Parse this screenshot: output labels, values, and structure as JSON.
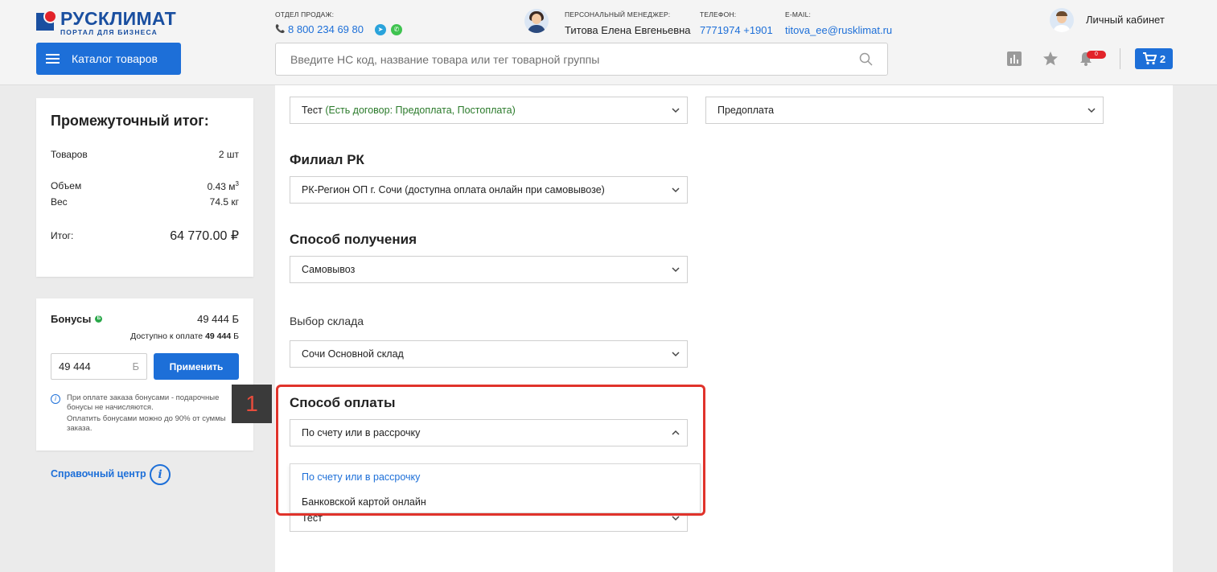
{
  "header": {
    "logo_name": "РУСКЛИМАТ",
    "logo_sub": "ПОРТАЛ ДЛЯ БИЗНЕСА",
    "sales_caption": "ОТДЕЛ ПРОДАЖ:",
    "sales_phone": "8 800 234 69 80",
    "manager_caption": "ПЕРСОНАЛЬНЫЙ МЕНЕДЖЕР:",
    "manager_name": "Титова Елена Евгеньевна",
    "phone_caption": "ТЕЛЕФОН:",
    "phone_value": "7771974 +1901",
    "email_caption": "E-MAIL:",
    "email_value": "titova_ee@rusklimat.ru",
    "cabinet_label": "Личный кабинет",
    "catalog_label": "Каталог товаров",
    "search_placeholder": "Введите НС код, название товара или тег товарной группы",
    "notifications_count": "0",
    "cart_count": "2",
    "accent_color": "#1d6fd8"
  },
  "summary": {
    "title": "Промежуточный итог:",
    "items_label": "Товаров",
    "items_value": "2 шт",
    "volume_label": "Объем",
    "volume_value": "0.43 м",
    "volume_sup": "3",
    "weight_label": "Вес",
    "weight_value": "74.5 кг",
    "total_label": "Итог:",
    "total_value": "64 770.00 ₽"
  },
  "bonus": {
    "title": "Бонусы",
    "badge": "Б",
    "value": "49 444 Б",
    "available_prefix": "Доступно к оплате",
    "available_value": "49 444",
    "available_unit": "Б",
    "input_value": "49 444",
    "input_unit": "Б",
    "apply_label": "Применить",
    "note_line1": "При оплате заказа бонусами - подарочные бонусы не начисляются.",
    "note_line2": "Оплатить бонусами можно до 90% от суммы заказа."
  },
  "help": {
    "label": "Справочный центр"
  },
  "form": {
    "contract_select": "Тест",
    "contract_note": "(Есть договор: Предоплата, Постоплата)",
    "payment_type_select": "Предоплата",
    "branch_title": "Филиал РК",
    "branch_select": "РК-Регион ОП г. Сочи (доступна оплата онлайн при самовывозе)",
    "delivery_title": "Способ получения",
    "delivery_select": "Самовывоз",
    "warehouse_label": "Выбор склада",
    "warehouse_select": "Сочи Основной склад",
    "payment_title": "Способ оплаты",
    "payment_select": "По счету или в рассрочку",
    "payment_options": [
      "По счету или в рассрочку",
      "Банковской картой онлайн"
    ],
    "bottom_select": "Тест"
  },
  "annotation": {
    "number": "1"
  }
}
